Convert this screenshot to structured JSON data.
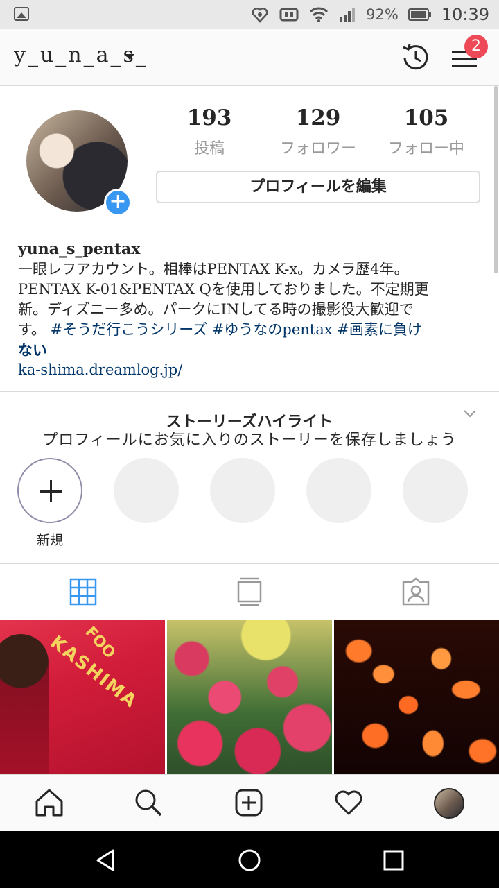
{
  "status_bar": {
    "battery": "92%",
    "time": "10:39"
  },
  "header": {
    "username": "y_u_n_a_s_",
    "notification_count": "2"
  },
  "profile": {
    "stats": [
      {
        "value": "193",
        "label": "投稿"
      },
      {
        "value": "129",
        "label": "フォロワー"
      },
      {
        "value": "105",
        "label": "フォロー中"
      }
    ],
    "edit_button": "プロフィールを編集",
    "name": "yuna_s_pentax",
    "bio_line1": "一眼レフアカウント。相棒はPENTAX K-x。カメラ歴4年。",
    "bio_line2": "PENTAX K-01&PENTAX Qを使用しておりました。不定期更",
    "bio_line3": "新。ディズニー多め。パークにINしてる時の撮影役大歓迎で",
    "bio_line4_prefix": "す。",
    "bio_tags_line4": "#そうだ行こうシリーズ #ゆうなのpentax #画素に負け",
    "bio_tags_line5": "ない",
    "website": "ka-shima.dreamlog.jp/"
  },
  "highlights": {
    "title": "ストーリーズハイライト",
    "subtitle": "プロフィールにお気に入りのストーリーを保存しましょう",
    "new_label": "新規"
  },
  "tabs": [
    "grid-icon",
    "feed-icon",
    "tagged-icon"
  ],
  "grid": {
    "cell1_text": "KASHIMA",
    "cell1_text2": "FOO"
  },
  "bottom_nav": [
    "home-icon",
    "search-icon",
    "add-post-icon",
    "heart-icon",
    "profile-avatar"
  ],
  "colors": {
    "accent_blue": "#3897f0",
    "badge_red": "#ed4956",
    "link_blue": "#003569"
  }
}
